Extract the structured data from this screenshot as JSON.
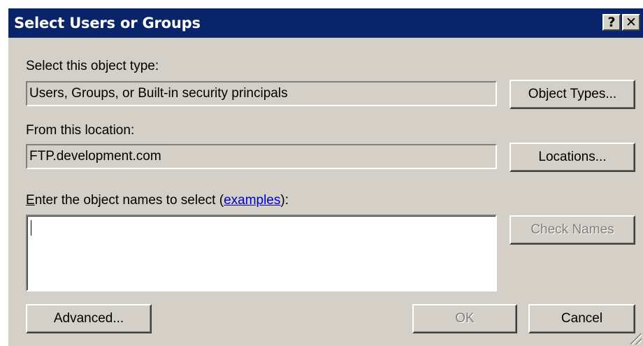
{
  "window": {
    "title": "Select Users or Groups",
    "help_glyph": "?",
    "close_glyph": "✕"
  },
  "object_type": {
    "label": "Select this object type:",
    "value": "Users, Groups, or Built-in security principals",
    "button": "Object Types..."
  },
  "location": {
    "label": "From this location:",
    "value": "FTP.development.com",
    "button": "Locations..."
  },
  "names": {
    "label_access_key": "E",
    "label_rest": "nter the object names to select (",
    "link": "examples",
    "label_end": "):",
    "value": "",
    "check_button": "Check Names"
  },
  "footer": {
    "advanced_button": "Advanced...",
    "ok_button": "OK",
    "cancel_button": "Cancel"
  }
}
